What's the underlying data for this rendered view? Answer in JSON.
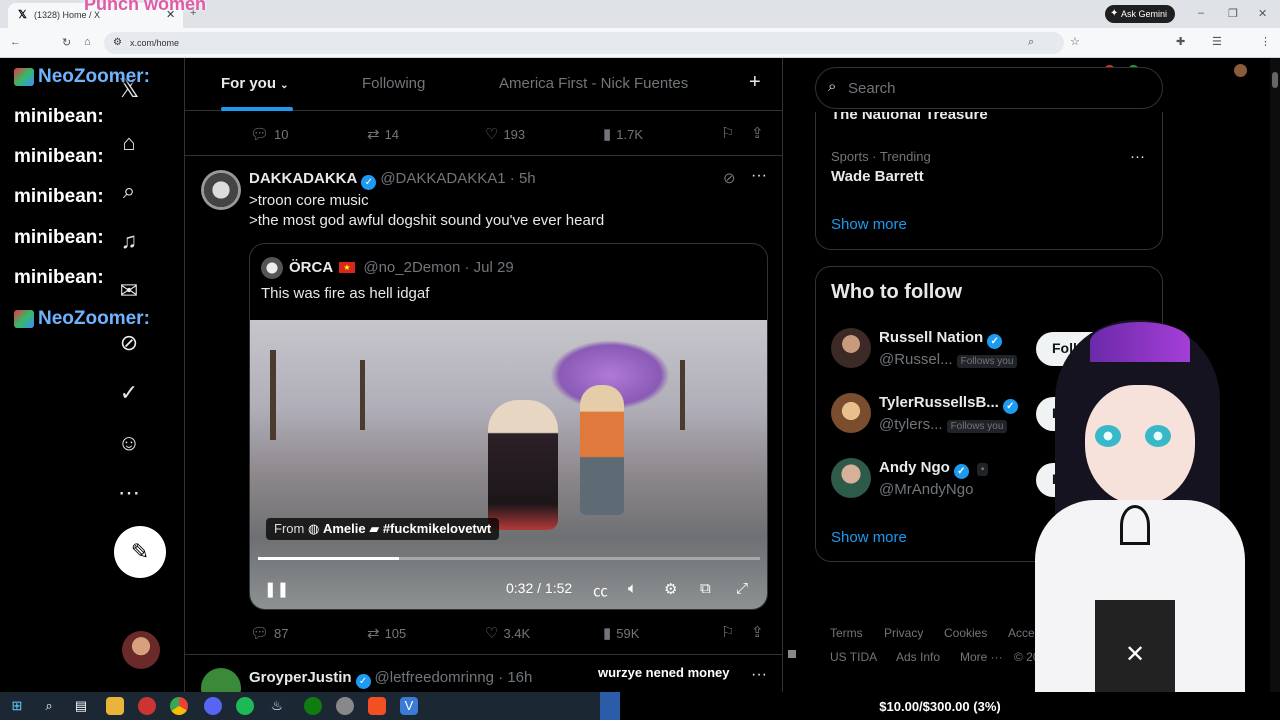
{
  "browser": {
    "tab_title": "(1328) Home / X",
    "url": "x.com/home",
    "gemini_label": "Ask Gemini"
  },
  "overlay": {
    "stream_title": "Punch women",
    "chat": [
      {
        "user": "NeoZoomer:",
        "color": "#6fb3ff"
      },
      {
        "user": "minibean:",
        "color": "#ffffff"
      },
      {
        "user": "minibean:",
        "color": "#ffffff"
      },
      {
        "user": "minibean:",
        "color": "#ffffff"
      },
      {
        "user": "minibean:",
        "color": "#ffffff"
      },
      {
        "user": "minibean:",
        "color": "#ffffff"
      },
      {
        "user": "NeoZoomer:",
        "color": "#6fb3ff"
      }
    ],
    "donor_text": "wurzye nened money",
    "donation_goal": "$10.00/$300.00 (3%)",
    "donation_progress": 0.03
  },
  "nav": {
    "icons": [
      "x-logo-icon",
      "home-icon",
      "search-icon",
      "notifications-icon",
      "messages-icon",
      "grok-icon",
      "verified-icon",
      "profile-icon",
      "more-icon"
    ],
    "post_icon": "compose-icon"
  },
  "tabs": [
    {
      "label": "For you",
      "active": true
    },
    {
      "label": "Following",
      "active": false
    },
    {
      "label": "America First - Nick Fuentes",
      "active": false
    }
  ],
  "prev_post_actions": {
    "replies": "10",
    "reposts": "14",
    "likes": "193",
    "views": "1.7K"
  },
  "post": {
    "name": "DAKKADAKKA",
    "handle": "@DAKKADAKKA1",
    "time": "5h",
    "line1": ">troon core music",
    "line2": ">the most god awful dogshit sound you've ever heard",
    "quote": {
      "name": "ÖRCA",
      "handle": "@no_2Demon",
      "date": "Jul 29",
      "text": "This was fire as hell idgaf",
      "from_label": "From",
      "from_user": "Amelie",
      "from_tag": "#fuckmikelovetwt",
      "video_time": "0:32 / 1:52",
      "video_progress": 0.28
    },
    "actions": {
      "replies": "87",
      "reposts": "105",
      "likes": "3.4K",
      "views": "59K"
    }
  },
  "next_post": {
    "name": "GroyperJustin",
    "handle": "@letfreedomrinng",
    "time": "16h"
  },
  "sidebar": {
    "search_placeholder": "Search",
    "trend_cutoff": "The National Treasure",
    "trend_category": "Sports · Trending",
    "trend_title": "Wade Barrett",
    "show_more": "Show more",
    "who_to_follow": "Who to follow",
    "follows_you": "Follows you",
    "follow_label": "Follow",
    "suggestions": [
      {
        "name": "Russell Nation",
        "handle": "@Russel...",
        "follows_you": true
      },
      {
        "name": "TylerRussellsB...",
        "handle": "@tylers...",
        "follows_you": true
      },
      {
        "name": "Andy Ngo",
        "handle": "@MrAndyNgo",
        "follows_you": false
      }
    ],
    "show_more_2": "Show more",
    "footer": {
      "terms": "Terms",
      "privacy": "Privacy",
      "cookies": "Cookies",
      "access": "Access",
      "usat": "US TIDA",
      "ads": "Ads Info",
      "more": "More ···",
      "copy": "© 20"
    }
  }
}
